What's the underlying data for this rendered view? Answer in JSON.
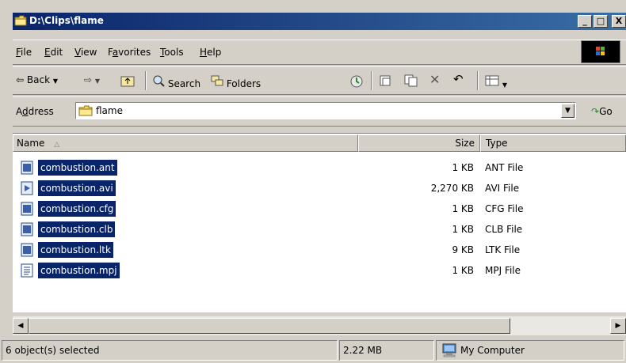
{
  "window": {
    "title": "D:\\Clips\\flame",
    "minimize": "_",
    "maximize": "□",
    "close": "X"
  },
  "menu": {
    "items": [
      {
        "ul": "F",
        "rest": "ile"
      },
      {
        "ul": "E",
        "rest": "dit"
      },
      {
        "ul": "V",
        "rest": "iew"
      },
      {
        "pre": "F",
        "ul": "a",
        "rest": "vorites"
      },
      {
        "ul": "T",
        "rest": "ools"
      },
      {
        "ul": "H",
        "rest": "elp"
      }
    ]
  },
  "toolbar": {
    "back_label": "Back",
    "search_label": "Search",
    "folders_label": "Folders"
  },
  "address": {
    "label_pre": "A",
    "label_ul": "d",
    "label_rest": "dress",
    "value": "flame",
    "go_label": "Go"
  },
  "columns": {
    "name": "Name",
    "size": "Size",
    "type": "Type"
  },
  "files": [
    {
      "name": "combustion.ant",
      "size": "1 KB",
      "type": "ANT File",
      "icon": "media-file-icon"
    },
    {
      "name": "combustion.avi",
      "size": "2,270 KB",
      "type": "AVI File",
      "icon": "video-file-icon"
    },
    {
      "name": "combustion.cfg",
      "size": "1 KB",
      "type": "CFG File",
      "icon": "media-file-icon"
    },
    {
      "name": "combustion.clb",
      "size": "1 KB",
      "type": "CLB File",
      "icon": "media-file-icon"
    },
    {
      "name": "combustion.ltk",
      "size": "9 KB",
      "type": "LTK File",
      "icon": "media-file-icon"
    },
    {
      "name": "combustion.mpj",
      "size": "1 KB",
      "type": "MPJ File",
      "icon": "text-file-icon"
    }
  ],
  "status": {
    "selection": "6 object(s) selected",
    "total_size": "2.22 MB",
    "zone": "My Computer"
  },
  "colors": {
    "titlebar": "#0a246a",
    "selection": "#0a246a",
    "chrome": "#d4d0c8"
  }
}
